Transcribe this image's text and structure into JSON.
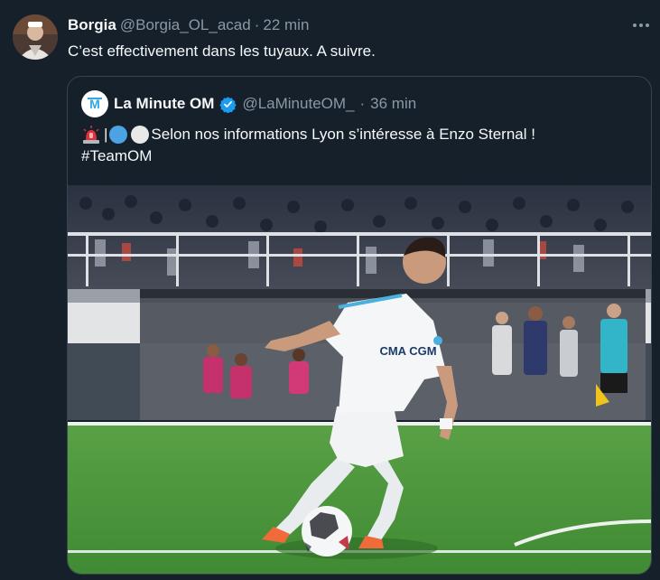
{
  "tweet": {
    "display_name": "Borgia",
    "handle": "@Borgia_OL_acad",
    "separator": "·",
    "time": "22 min",
    "text": "C’est effectivement dans les tuyaux. A suivre."
  },
  "quoted": {
    "display_name": "La Minute OM",
    "handle": "@LaMinuteOM_",
    "separator": "·",
    "time": "36 min",
    "text_line1": "| ",
    "text_line1_rest": " Selon nos informations Lyon s’intéresse à Enzo Sternal !",
    "hashtag": "#TeamOM",
    "emoji": [
      "rotating-light-emoji",
      "blue-circle-emoji",
      "white-circle-emoji"
    ],
    "media": {
      "sponsor_text": "CMA CGM"
    }
  },
  "colors": {
    "background": "#15202b",
    "primary_text": "#f7f9f9",
    "secondary_text": "#8b98a5",
    "border": "#38444d",
    "verified_blue": "#1d9bf0",
    "pitch_green": "#4f9a3e"
  },
  "icons": [
    "more-icon",
    "verified-badge-icon",
    "om-logo-icon"
  ]
}
